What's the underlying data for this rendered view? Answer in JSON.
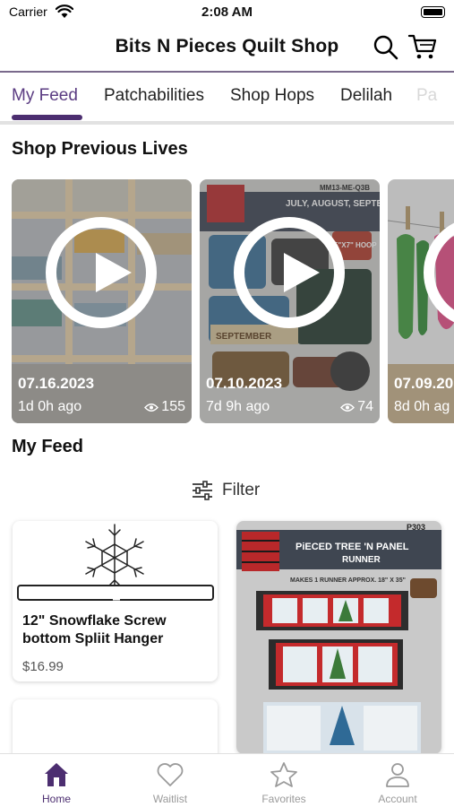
{
  "status_bar": {
    "carrier": "Carrier",
    "time": "2:08 AM"
  },
  "header": {
    "title": "Bits N Pieces Quilt Shop",
    "icons": [
      "search-icon",
      "cart-icon"
    ]
  },
  "tabs": [
    {
      "label": "My Feed",
      "active": true
    },
    {
      "label": "Patchabilities"
    },
    {
      "label": "Shop Hops"
    },
    {
      "label": "Delilah"
    },
    {
      "label": "Pa"
    }
  ],
  "lives": {
    "title": "Shop Previous Lives",
    "items": [
      {
        "date": "07.16.2023",
        "ago": "1d 0h ago",
        "views": "155"
      },
      {
        "date": "07.10.2023",
        "ago": "7d 9h ago",
        "views": "74",
        "image_text": {
          "code": "MM13-ME-Q3B",
          "heading": "JULY, AUGUST, SEPTEMBER",
          "hoop": "5\"X7\" HOOP",
          "month": "SEPTEMBER"
        }
      },
      {
        "date": "07.09.20",
        "ago": "8d 0h ag"
      }
    ]
  },
  "feed": {
    "title": "My Feed",
    "filter_label": "Filter",
    "products": [
      {
        "name": "12\" Snowflake Screw bottom Spliit Hanger",
        "price": "$16.99"
      },
      {
        "image_text": {
          "code": "P303",
          "title": "PiECED TREE 'N PANEL",
          "subtitle": "RUNNER",
          "tagline": "MAKES 1 RUNNER APPROX. 18\" X 35\""
        }
      }
    ]
  },
  "bottom_nav": [
    {
      "label": "Home",
      "icon": "home-icon",
      "active": true
    },
    {
      "label": "Waitlist",
      "icon": "heart-icon"
    },
    {
      "label": "Favorites",
      "icon": "star-icon"
    },
    {
      "label": "Account",
      "icon": "person-icon"
    }
  ],
  "colors": {
    "accent": "#4c2e70",
    "tab_active": "#5b3c82",
    "header_line": "#7a6a8c",
    "inactive_nav": "#9a9a9a"
  }
}
